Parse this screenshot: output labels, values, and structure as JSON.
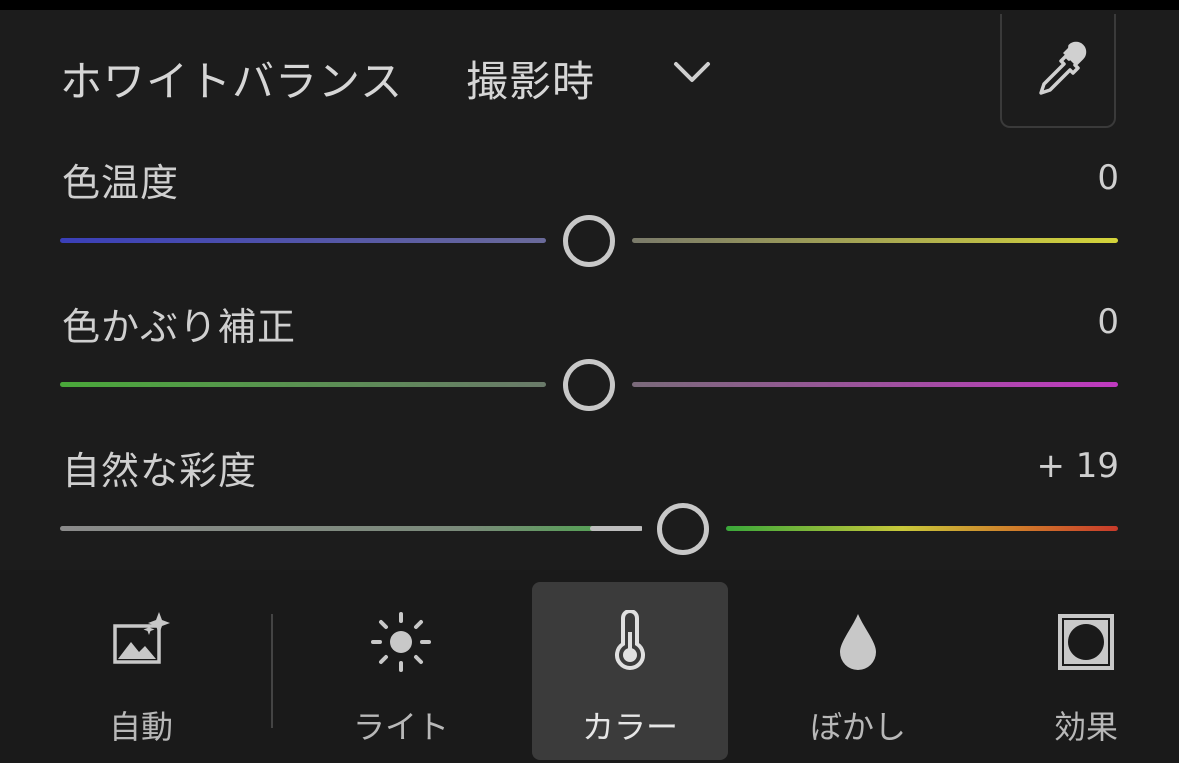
{
  "header": {
    "label": "ホワイトバランス",
    "value": "撮影時"
  },
  "sliders": [
    {
      "label": "色温度",
      "value": "0",
      "level": 0
    },
    {
      "label": "色かぶり補正",
      "value": "0",
      "level": 0
    },
    {
      "label": "自然な彩度",
      "value": "+ 19",
      "level": 19
    }
  ],
  "tabs": [
    {
      "label": "自動",
      "icon": "auto-photo-icon"
    },
    {
      "label": "ライト",
      "icon": "sun-icon"
    },
    {
      "label": "カラー",
      "icon": "thermometer-icon",
      "active": true
    },
    {
      "label": "ぼかし",
      "icon": "droplet-icon"
    },
    {
      "label": "効果",
      "icon": "vignette-icon"
    }
  ]
}
